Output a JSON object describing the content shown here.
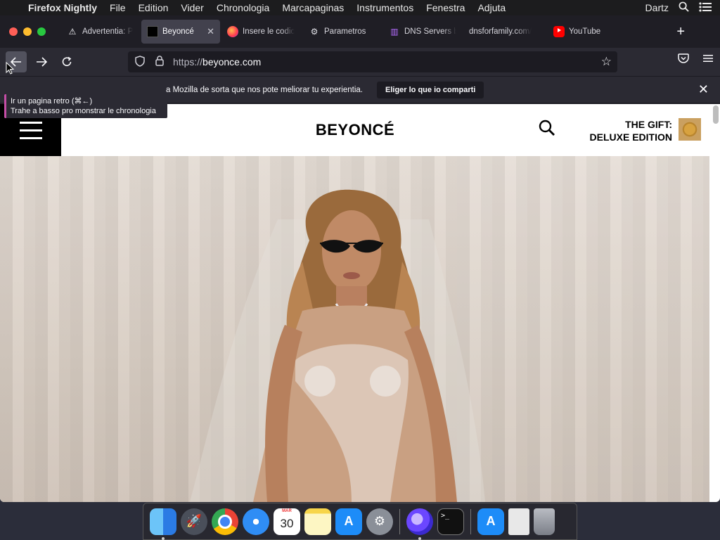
{
  "menubar": {
    "app_name": "Firefox Nightly",
    "items": [
      "File",
      "Edition",
      "Vider",
      "Chronologia",
      "Marcapaginas",
      "Instrumentos",
      "Fenestra",
      "Adjuta"
    ],
    "user": "Dartz"
  },
  "tabs": [
    {
      "label": "Advertentia: P",
      "icon": "warning-icon"
    },
    {
      "label": "Beyoncé",
      "icon": "black-square-icon",
      "active": true
    },
    {
      "label": "Insere le codic",
      "icon": "firefox-icon"
    },
    {
      "label": "Parametros",
      "icon": "gear-icon"
    },
    {
      "label": "DNS Servers b",
      "icon": "dns-icon"
    },
    {
      "label": "dnsforfamily.com/",
      "icon": ""
    },
    {
      "label": "YouTube",
      "icon": "youtube-icon"
    }
  ],
  "urlbar": {
    "prefix": "https://",
    "host": "beyonce.com"
  },
  "notification": {
    "text": "a Mozilla de sorta que nos pote meliorar tu experientia.",
    "button_label": "Eliger lo que io comparti"
  },
  "tooltip": {
    "line1": "Ir un pagina retro (⌘←)",
    "line2": "Trahe a basso pro monstrar le chronologia"
  },
  "site": {
    "logo": "BEYONCÉ",
    "promo_line1": "THE GIFT:",
    "promo_line2": "DELUXE EDITION"
  },
  "dock": {
    "calendar_month": "MAR",
    "calendar_day": "30"
  },
  "colors": {
    "browser_bg": "#1f1e25",
    "toolbar_bg": "#2b2a33",
    "active_tab": "#42414d",
    "tooltip_accent": "#c54da6"
  }
}
